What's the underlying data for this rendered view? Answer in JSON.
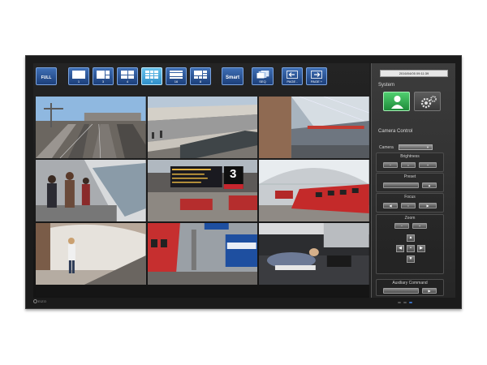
{
  "brand": {
    "logo_text": "EIZO"
  },
  "toolbar": {
    "buttons": [
      {
        "id": "full",
        "label": "FULL"
      },
      {
        "id": "layout-1",
        "label": "1"
      },
      {
        "id": "layout-3",
        "label": "3"
      },
      {
        "id": "layout-4",
        "label": "4"
      },
      {
        "id": "layout-9",
        "label": "9",
        "active": true
      },
      {
        "id": "layout-16",
        "label": "16"
      },
      {
        "id": "layout-8",
        "label": "8"
      },
      {
        "id": "smart",
        "label": "Smart"
      },
      {
        "id": "seq",
        "label": "SEQ"
      },
      {
        "id": "page-prev",
        "label": "PAGE -"
      },
      {
        "id": "page-next",
        "label": "PAGE +"
      }
    ]
  },
  "cameras": {
    "tile_5_sign_number": "3"
  },
  "control": {
    "datetime": "2016/04/05 09:11:39",
    "system_title": "System",
    "camera_control_title": "Camera Control",
    "camera_label": "Camera",
    "brightness_label": "Brightness",
    "preset_label": "Preset",
    "focus_label": "Focus",
    "zoom_label": "Zoom",
    "auxiliary_label": "Auxiliary Command"
  },
  "colors": {
    "active_button": "#47a8dc",
    "toolbar_button": "#2d5aa0",
    "system_user_button": "#2fae4e",
    "bezel": "#1b1b1b"
  }
}
